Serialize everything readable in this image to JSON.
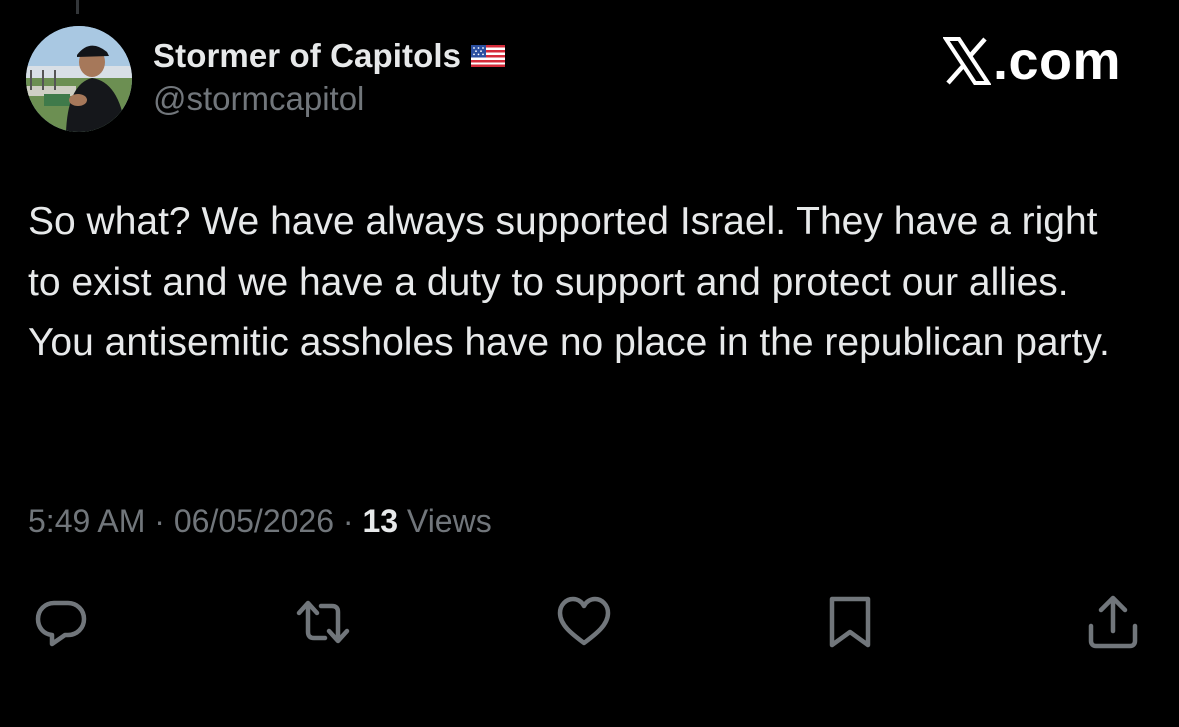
{
  "tweet": {
    "author": {
      "display_name": "Stormer of Capitols",
      "handle": "@stormcapitol",
      "name_badge": "us-flag-icon"
    },
    "brand": {
      "text": ".com",
      "icon": "x-logo-icon"
    },
    "text": "So what? We have always supported Israel. They have a right to exist and we have a duty to support and protect our allies. You antisemitic assholes have no place in the republican party.",
    "time": "5:49 AM",
    "separator": " · ",
    "date": "06/05/2026",
    "views_count": "13",
    "views_label": " Views"
  },
  "actions": [
    {
      "name": "reply",
      "icon": "reply-icon"
    },
    {
      "name": "retweet",
      "icon": "retweet-icon"
    },
    {
      "name": "like",
      "icon": "heart-icon"
    },
    {
      "name": "bookmark",
      "icon": "bookmark-icon"
    },
    {
      "name": "share",
      "icon": "share-icon"
    }
  ],
  "colors": {
    "background": "#000000",
    "primary_text": "#e7e9ea",
    "secondary_text": "#71767b",
    "icon": "#71767b"
  }
}
